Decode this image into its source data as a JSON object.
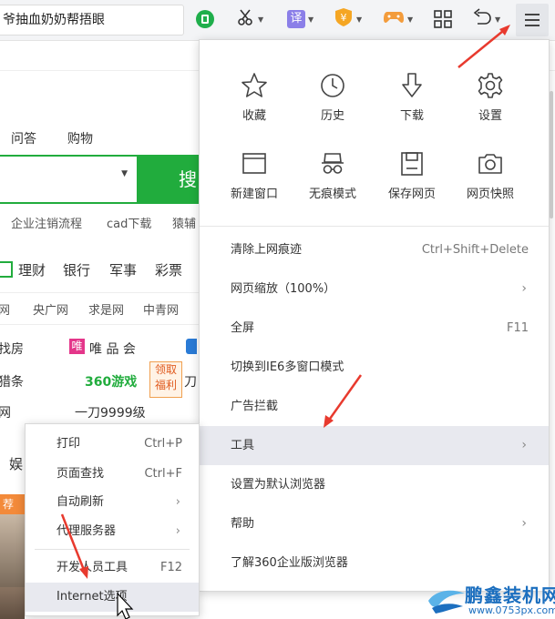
{
  "toolbar": {
    "address_text": "爷抽血奶奶帮捂眼",
    "icons": [
      "app-icon",
      "scissors-icon",
      "translate-icon",
      "shield-icon",
      "gamepad-icon",
      "grid-icon",
      "undo-icon",
      "menu-icon"
    ],
    "translate_glyph": "译",
    "shield_glyph": "¥"
  },
  "background": {
    "tabs": [
      "问答",
      "购物"
    ],
    "search_button": "搜",
    "links_row1": [
      "企业注销流程",
      "cad下载",
      "猿辅"
    ],
    "nav": [
      "理财",
      "银行",
      "军事",
      "彩票"
    ],
    "sites": [
      "网",
      "央广网",
      "求是网",
      "中青网"
    ],
    "row_a": [
      "找房",
      "唯 品 会"
    ],
    "row_b": [
      "猎条",
      "360游戏"
    ],
    "badge": [
      "领取",
      "福利"
    ],
    "row_c": [
      "网",
      "一刀9999级"
    ],
    "side_char": "娱",
    "tag": "荐"
  },
  "main_menu": {
    "quick": [
      {
        "label": "收藏",
        "icon": "star-icon"
      },
      {
        "label": "历史",
        "icon": "clock-icon"
      },
      {
        "label": "下载",
        "icon": "download-icon"
      },
      {
        "label": "设置",
        "icon": "gear-icon"
      },
      {
        "label": "新建窗口",
        "icon": "new-window-icon"
      },
      {
        "label": "无痕模式",
        "icon": "incognito-icon"
      },
      {
        "label": "保存网页",
        "icon": "save-icon"
      },
      {
        "label": "网页快照",
        "icon": "camera-icon"
      }
    ],
    "items": [
      {
        "label": "清除上网痕迹",
        "shortcut": "Ctrl+Shift+Delete"
      },
      {
        "label": "网页缩放（100%）",
        "arrow": "›"
      },
      {
        "label": "全屏",
        "shortcut": "F11"
      },
      {
        "label": "切换到IE6多窗口模式"
      },
      {
        "label": "广告拦截"
      },
      {
        "label": "工具",
        "arrow": "›"
      },
      {
        "label": "设置为默认浏览器"
      },
      {
        "label": "帮助",
        "arrow": "›"
      },
      {
        "label": "了解360企业版浏览器"
      }
    ]
  },
  "tools_submenu": {
    "items": [
      {
        "label": "打印",
        "shortcut": "Ctrl+P"
      },
      {
        "label": "页面查找",
        "shortcut": "Ctrl+F"
      },
      {
        "label": "自动刷新",
        "arrow": "›"
      },
      {
        "label": "代理服务器",
        "arrow": "›"
      },
      {
        "label": "开发人员工具",
        "shortcut": "F12"
      },
      {
        "label": "Internet选项"
      }
    ]
  },
  "watermark": {
    "title": "鹏鑫装机网",
    "url": "www.0753px.com"
  },
  "colors": {
    "accent_green": "#21ac3d",
    "arrow_red": "#e83a2e",
    "highlight": "#e8e9ef"
  }
}
